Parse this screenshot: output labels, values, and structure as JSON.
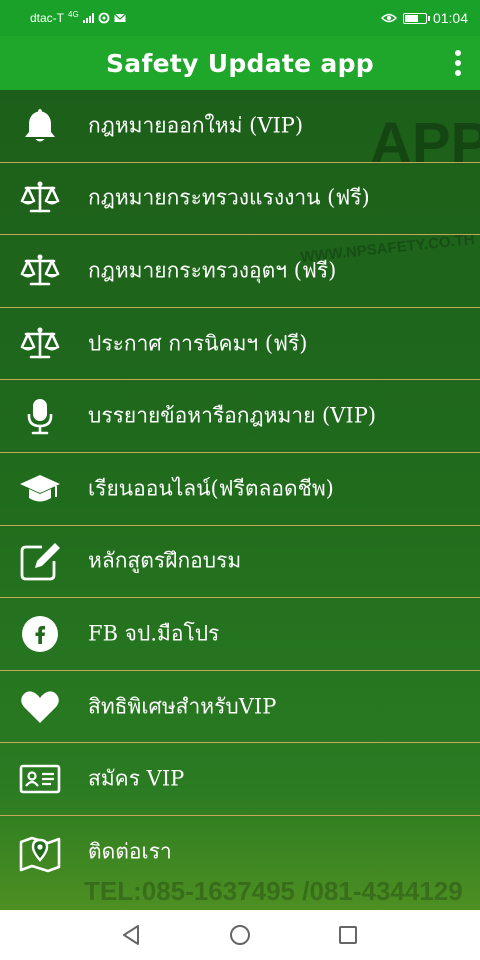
{
  "status_bar": {
    "carrier": "dtac-T",
    "network": "4G",
    "time": "01:04",
    "battery_level": 0.7
  },
  "app_bar": {
    "title": "Safety Update app",
    "menu_icon": "more-vert-icon"
  },
  "watermark": {
    "brand": "APP",
    "url": "WWW.NPSAFETY.CO.TH",
    "phone": "TEL:085-1637495 /081-4344129"
  },
  "menu": {
    "items": [
      {
        "icon": "bell-icon",
        "label": "กฎหมายออกใหม่ (VIP)"
      },
      {
        "icon": "scales-icon",
        "label": "กฎหมายกระทรวงแรงงาน (ฟรี)"
      },
      {
        "icon": "scales-icon",
        "label": "กฎหมายกระทรวงอุตฯ (ฟรี)"
      },
      {
        "icon": "scales-icon",
        "label": "ประกาศ การนิคมฯ (ฟรี)"
      },
      {
        "icon": "microphone-icon",
        "label": "บรรยายข้อหารือกฎหมาย (VIP)"
      },
      {
        "icon": "graduation-cap-icon",
        "label": "เรียนออนไลน์(ฟรีตลอดชีพ)"
      },
      {
        "icon": "edit-icon",
        "label": "หลักสูตรฝึกอบรม"
      },
      {
        "icon": "facebook-icon",
        "label": "FB จป.มือโปร"
      },
      {
        "icon": "heart-icon",
        "label": "สิทธิพิเศษสำหรับVIP"
      },
      {
        "icon": "id-card-icon",
        "label": "สมัคร VIP"
      },
      {
        "icon": "map-pin-icon",
        "label": "ติดต่อเรา"
      }
    ]
  },
  "nav_bar": {
    "back_icon": "back-triangle-icon",
    "home_icon": "home-circle-icon",
    "recents_icon": "recents-square-icon"
  },
  "colors": {
    "status_bar": "#1aa12a",
    "app_bar": "#1ea72a",
    "content_bg": "#1d5f1a",
    "divider": "#c7a75a",
    "text": "#ffffff",
    "nav_bar": "#ffffff"
  }
}
